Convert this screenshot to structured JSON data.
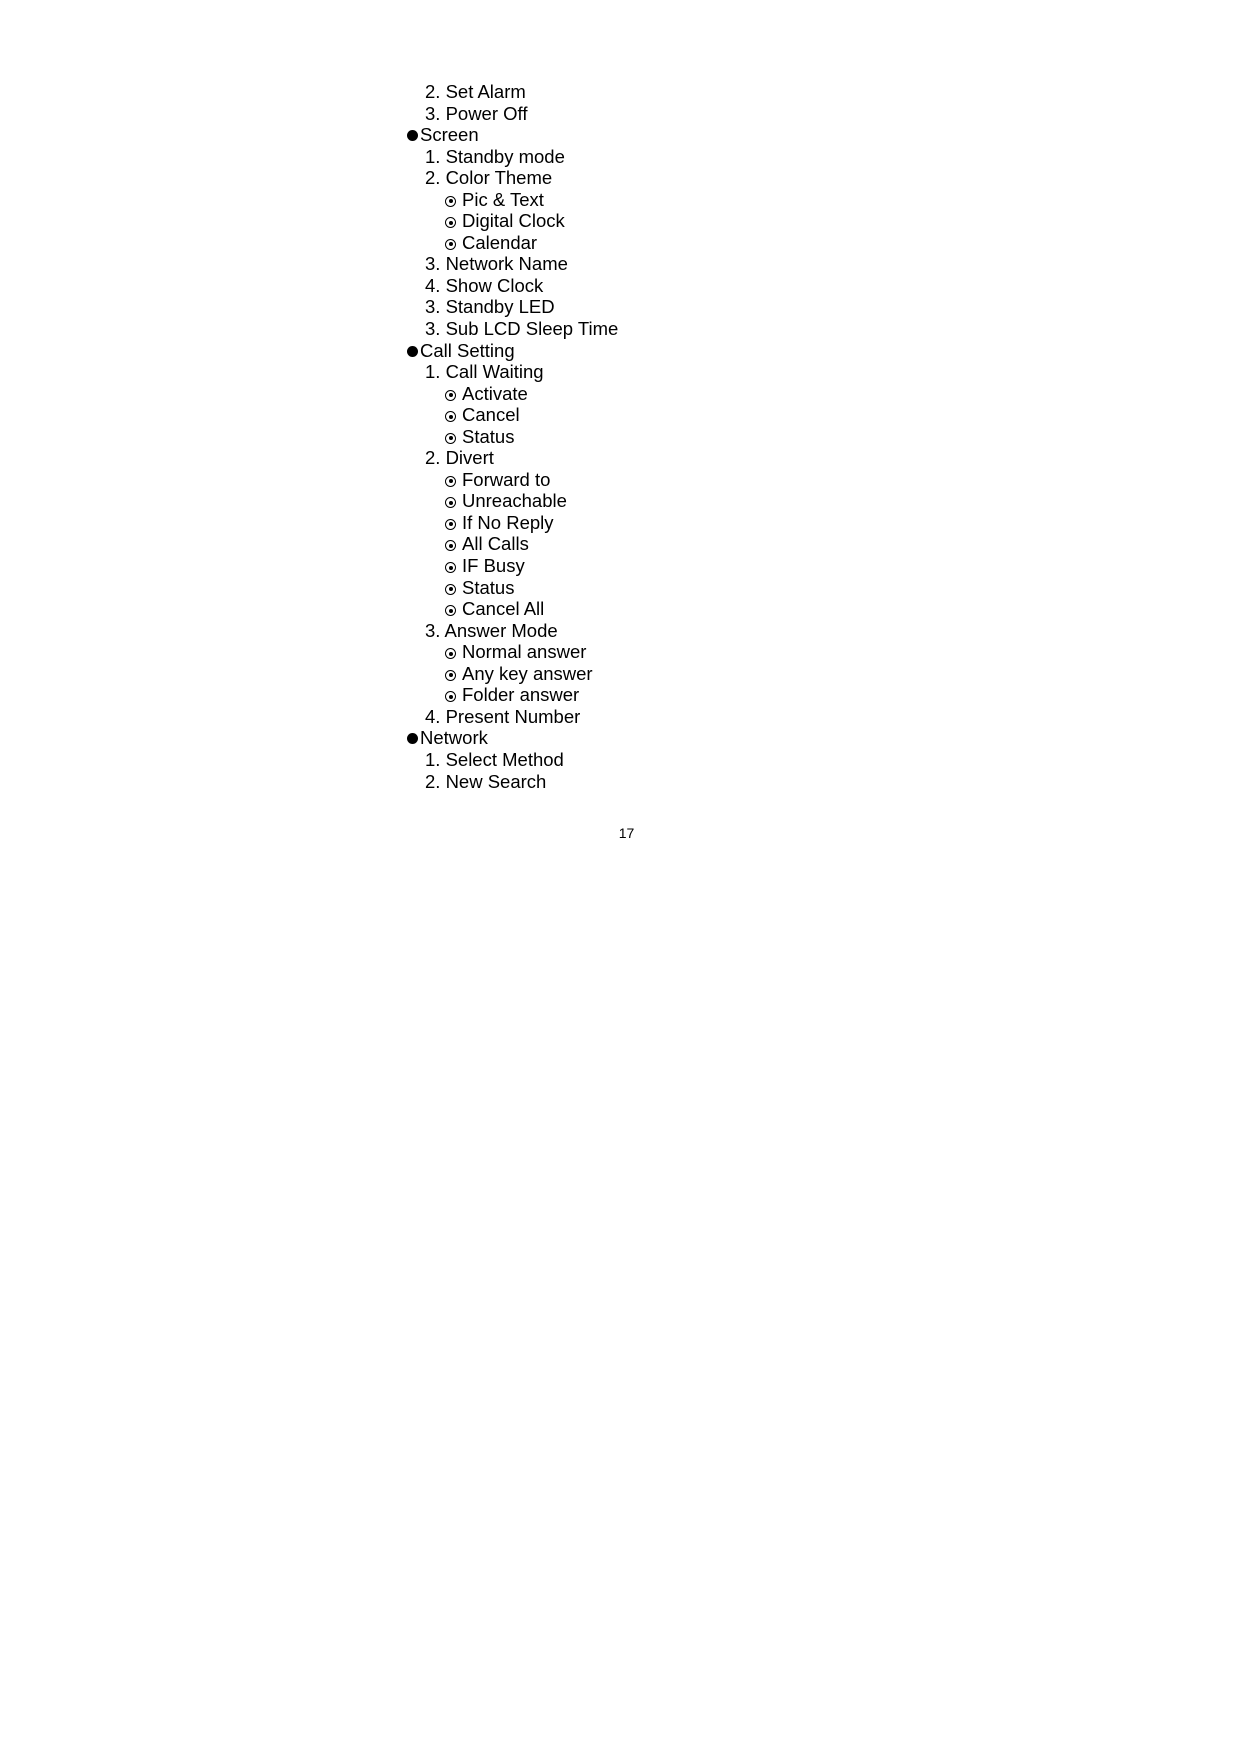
{
  "document": {
    "items": [
      {
        "level": 2,
        "text": "2. Set Alarm"
      },
      {
        "level": 2,
        "text": "3. Power Off"
      },
      {
        "level": 1,
        "text": "Screen"
      },
      {
        "level": 2,
        "text": "1. Standby mode"
      },
      {
        "level": 2,
        "text": "2. Color Theme"
      },
      {
        "level": 3,
        "text": "Pic & Text"
      },
      {
        "level": 3,
        "text": "Digital Clock"
      },
      {
        "level": 3,
        "text": "Calendar"
      },
      {
        "level": 2,
        "text": "3. Network Name"
      },
      {
        "level": 2,
        "text": "4. Show Clock"
      },
      {
        "level": 2,
        "text": "3. Standby LED"
      },
      {
        "level": 2,
        "text": "3. Sub LCD Sleep Time"
      },
      {
        "level": 1,
        "text": "Call Setting"
      },
      {
        "level": 2,
        "text": "1. Call Waiting"
      },
      {
        "level": 3,
        "text": "Activate"
      },
      {
        "level": 3,
        "text": "Cancel"
      },
      {
        "level": 3,
        "text": "Status"
      },
      {
        "level": 2,
        "text": "2. Divert"
      },
      {
        "level": 3,
        "text": "Forward to"
      },
      {
        "level": 3,
        "text": "Unreachable"
      },
      {
        "level": 3,
        "text": "If No Reply"
      },
      {
        "level": 3,
        "text": "All Calls"
      },
      {
        "level": 3,
        "text": "IF Busy"
      },
      {
        "level": 3,
        "text": "Status"
      },
      {
        "level": 3,
        "text": "Cancel All"
      },
      {
        "level": 2,
        "text": "3. Answer Mode"
      },
      {
        "level": 3,
        "text": "Normal answer"
      },
      {
        "level": 3,
        "text": "Any key answer"
      },
      {
        "level": 3,
        "text": "Folder answer"
      },
      {
        "level": 2,
        "text": "4. Present Number"
      },
      {
        "level": 1,
        "text": "Network"
      },
      {
        "level": 2,
        "text": "1. Select Method"
      },
      {
        "level": 2,
        "text": "2. New Search"
      }
    ],
    "page_number": "17"
  },
  "icons": {
    "level1": "filled-circle-bullet-icon",
    "level3": "circled-dot-bullet-icon"
  }
}
